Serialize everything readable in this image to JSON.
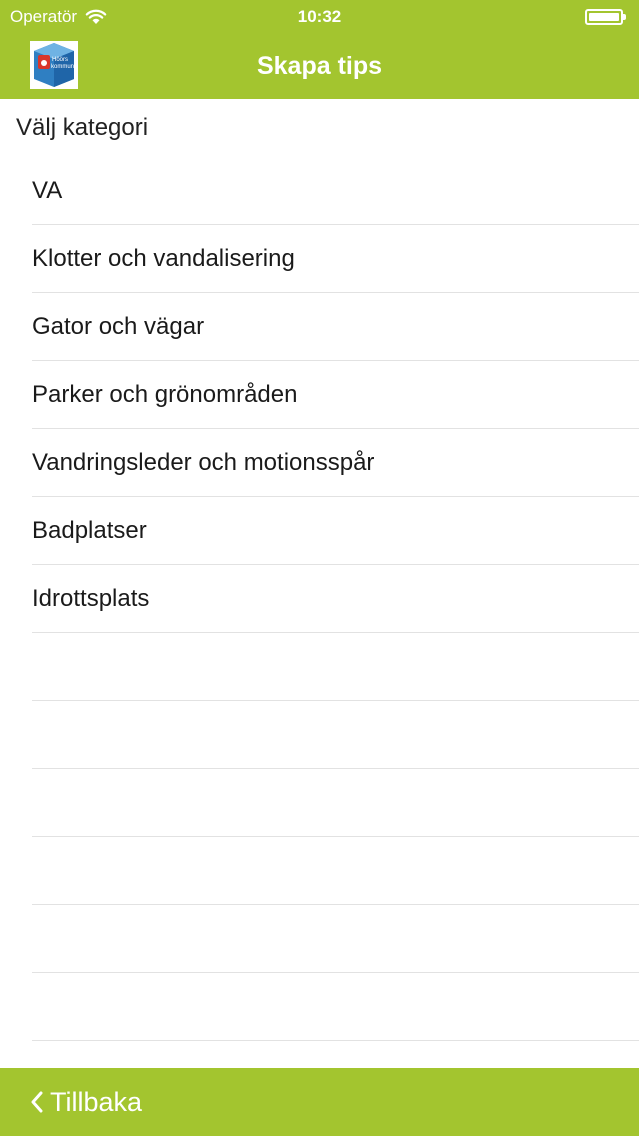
{
  "status_bar": {
    "carrier": "Operatör",
    "time": "10:32"
  },
  "nav": {
    "title": "Skapa tips",
    "logo_text_1": "Höörs",
    "logo_text_2": "kommun"
  },
  "section_label": "Välj kategori",
  "categories": [
    "VA",
    "Klotter och vandalisering",
    "Gator och vägar",
    "Parker och grönområden",
    "Vandringsleder och motionsspår",
    "Badplatser",
    "Idrottsplats"
  ],
  "bottom_bar": {
    "back_label": "Tillbaka"
  },
  "colors": {
    "accent": "#a3c52f",
    "separator": "#e2e2e2"
  },
  "icons": {
    "wifi": "wifi-icon",
    "battery": "battery-icon",
    "back": "chevron-left-icon",
    "logo": "hoor-kommun-logo"
  }
}
